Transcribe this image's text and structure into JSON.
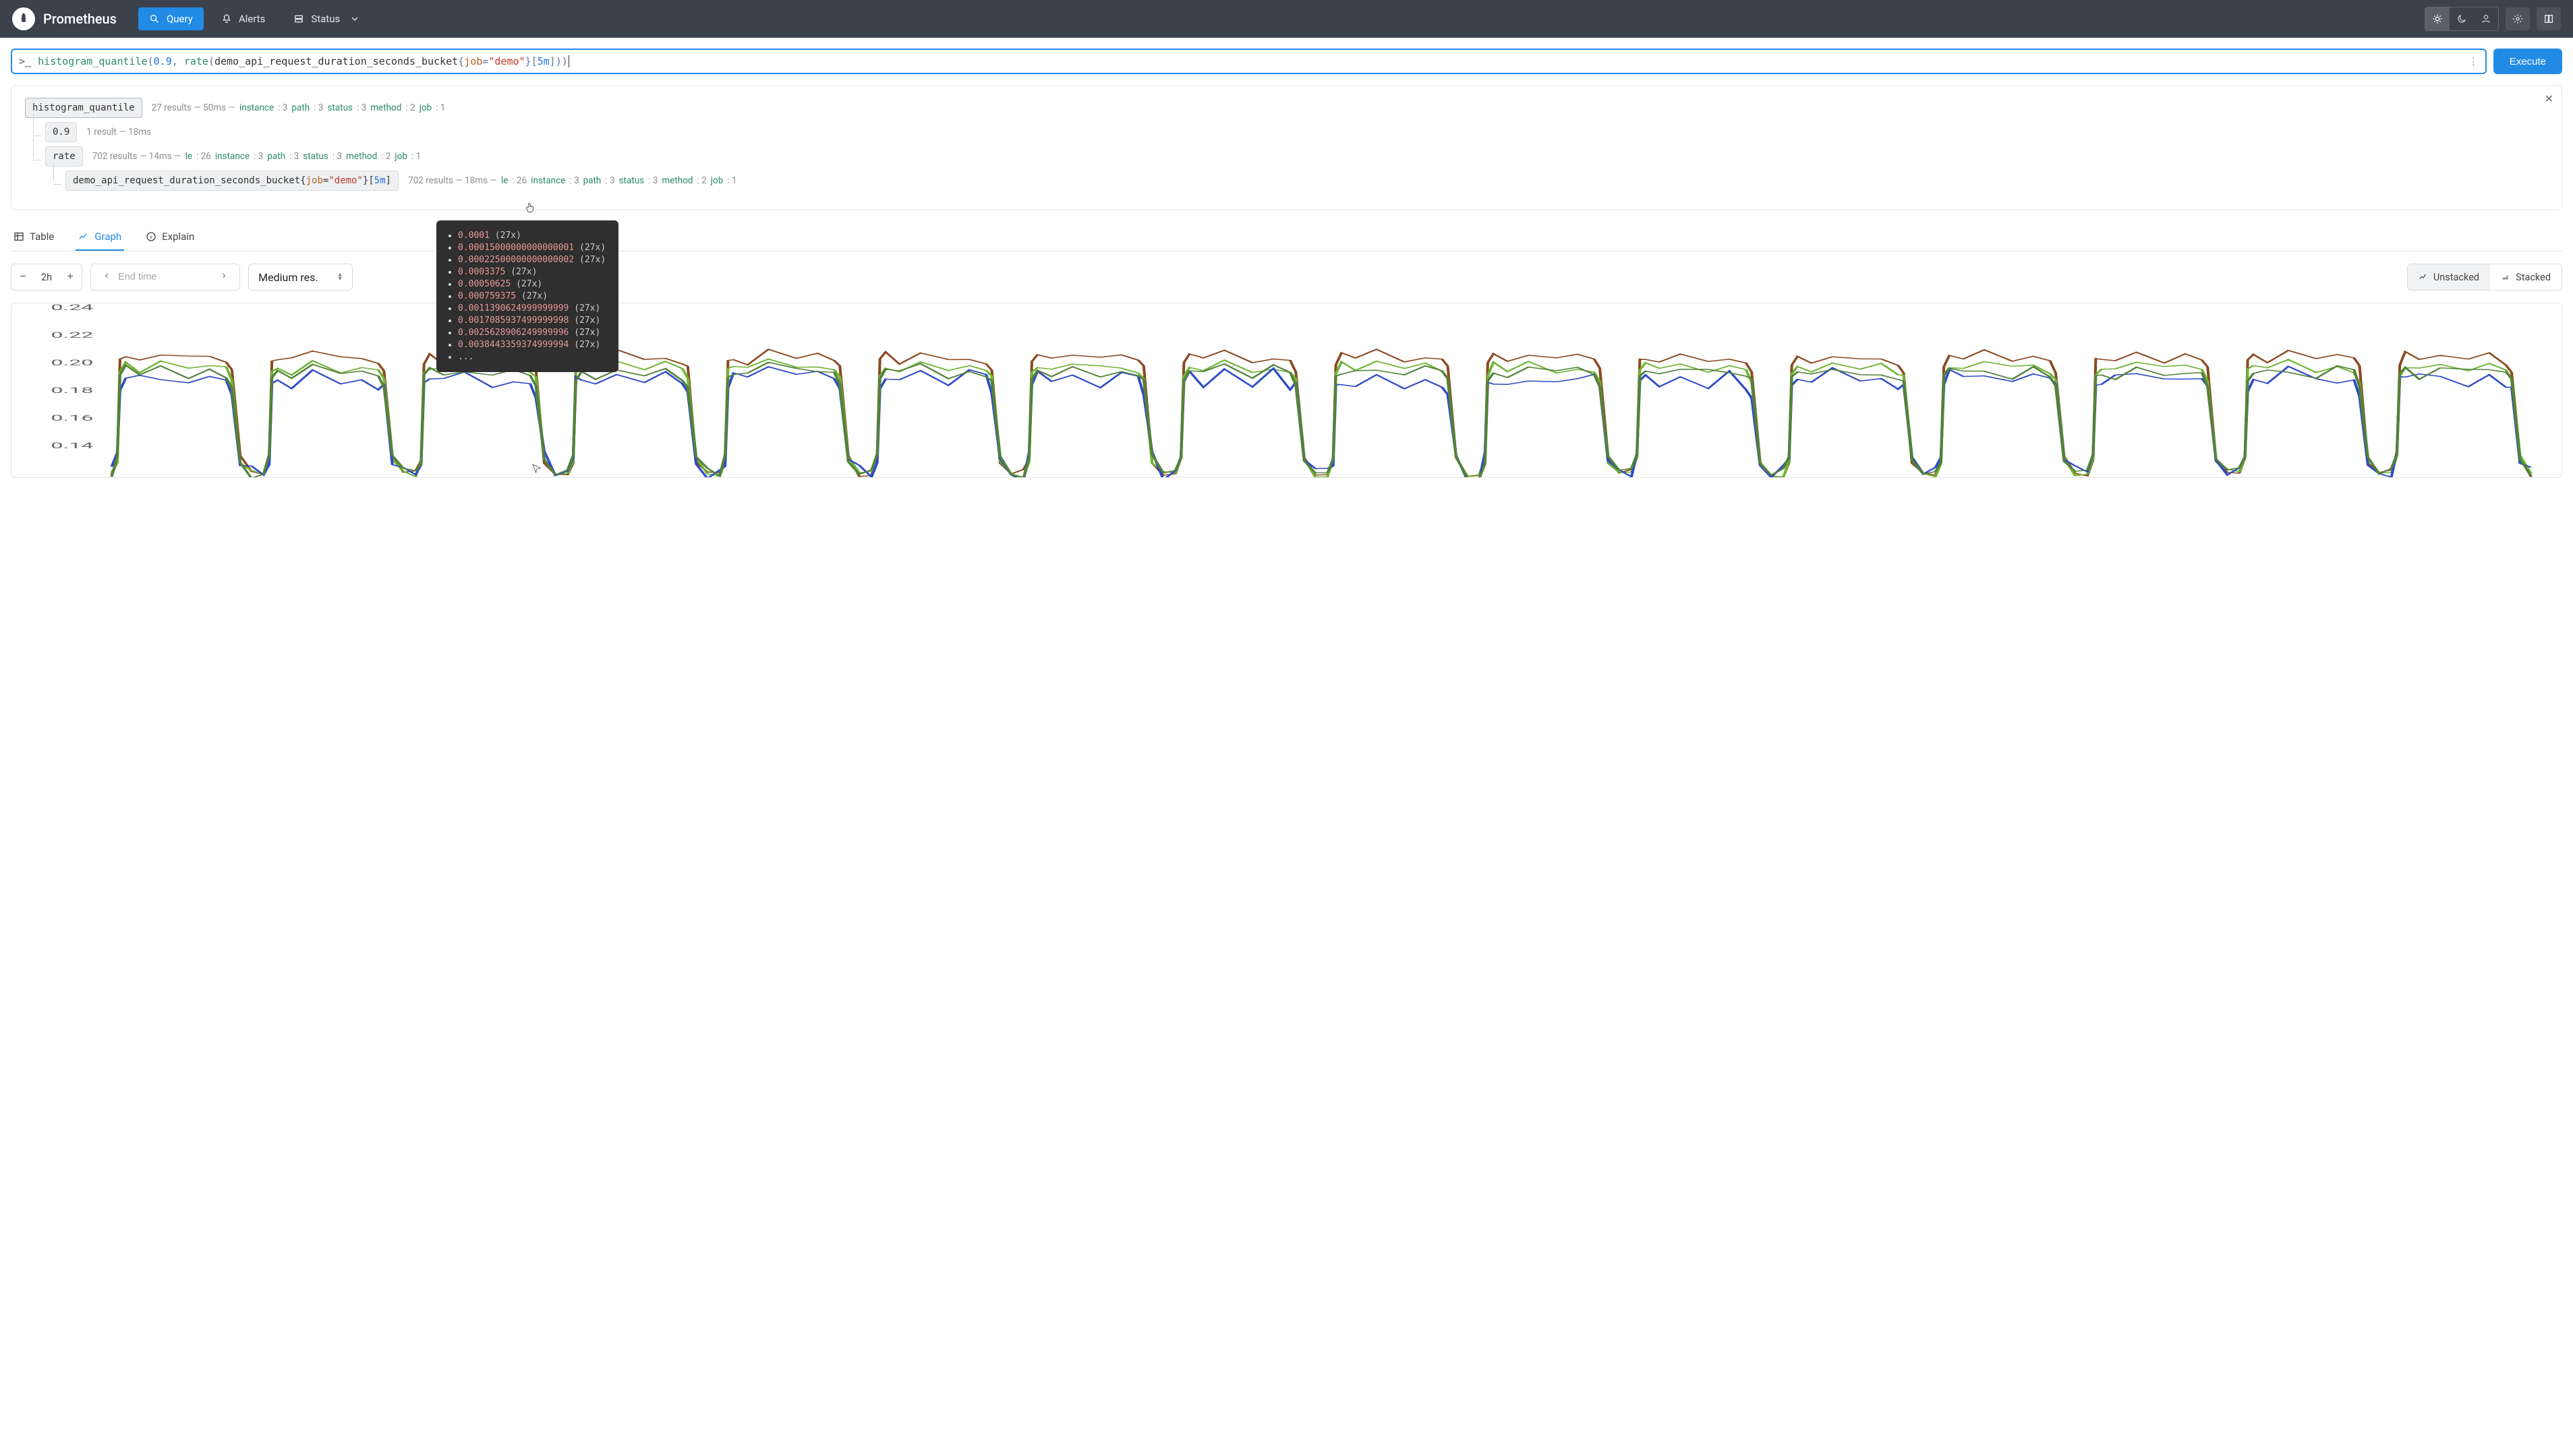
{
  "app": {
    "name": "Prometheus"
  },
  "nav": {
    "query": "Query",
    "alerts": "Alerts",
    "status": "Status"
  },
  "query": {
    "func1": "histogram_quantile",
    "quantile": "0.9",
    "func2": "rate",
    "metric": "demo_api_request_duration_seconds_bucket",
    "label_key": "job",
    "label_val": "\"demo\"",
    "range": "5m",
    "execute": "Execute"
  },
  "tree": {
    "n0": {
      "chip": "histogram_quantile",
      "meta_prefix": "27 results  —  50ms  —",
      "labels": [
        [
          "instance",
          "3"
        ],
        [
          "path",
          "3"
        ],
        [
          "status",
          "3"
        ],
        [
          "method",
          "2"
        ],
        [
          "job",
          "1"
        ]
      ]
    },
    "n1": {
      "chip": "0.9",
      "meta_prefix": "1 result  —  18ms"
    },
    "n2": {
      "chip": "rate",
      "meta_prefix": "702 results  —  14ms  —",
      "labels": [
        [
          "le",
          "26"
        ],
        [
          "instance",
          "3"
        ],
        [
          "path",
          "3"
        ],
        [
          "status",
          "3"
        ],
        [
          "method",
          "2"
        ],
        [
          "job",
          "1"
        ]
      ]
    },
    "n3": {
      "chip_metric": "demo_api_request_duration_seconds_bucket",
      "chip_lk": "job",
      "chip_lv": "\"demo\"",
      "chip_range": "5m",
      "meta_prefix": "702 results  —  18ms  —",
      "labels": [
        [
          "le",
          "26"
        ],
        [
          "instance",
          "3"
        ],
        [
          "path",
          "3"
        ],
        [
          "status",
          "3"
        ],
        [
          "method",
          "2"
        ],
        [
          "job",
          "1"
        ]
      ]
    }
  },
  "tooltip": {
    "items": [
      {
        "v": "0.0001",
        "c": "(27x)"
      },
      {
        "v": "0.00015000000000000001",
        "c": "(27x)"
      },
      {
        "v": "0.00022500000000000002",
        "c": "(27x)"
      },
      {
        "v": "0.0003375",
        "c": "(27x)"
      },
      {
        "v": "0.00050625",
        "c": "(27x)"
      },
      {
        "v": "0.000759375",
        "c": "(27x)"
      },
      {
        "v": "0.0011390624999999999",
        "c": "(27x)"
      },
      {
        "v": "0.0017085937499999998",
        "c": "(27x)"
      },
      {
        "v": "0.0025628906249999996",
        "c": "(27x)"
      },
      {
        "v": "0.0038443359374999994",
        "c": "(27x)"
      }
    ],
    "more": "..."
  },
  "tabs": {
    "table": "Table",
    "graph": "Graph",
    "explain": "Explain"
  },
  "controls": {
    "range": "2h",
    "end_placeholder": "End time",
    "resolution": "Medium res.",
    "unstacked": "Unstacked",
    "stacked": "Stacked"
  },
  "chart_data": {
    "type": "line",
    "ylim": [
      0.12,
      0.24
    ],
    "yticks": [
      0.14,
      0.16,
      0.18,
      0.2,
      0.22,
      0.24
    ],
    "cycles": 16,
    "cycle_shape_x": [
      0.0,
      0.04,
      0.06,
      0.1,
      0.2,
      0.35,
      0.55,
      0.7,
      0.82,
      0.86,
      0.92,
      1.0
    ],
    "series": [
      {
        "name": "s1",
        "color": "#8a4a20",
        "high": 0.205,
        "low": 0.12,
        "jitter": 0.003
      },
      {
        "name": "s2",
        "color": "#6fb436",
        "high": 0.198,
        "low": 0.12,
        "jitter": 0.003
      },
      {
        "name": "s3",
        "color": "#2e4bc7",
        "high": 0.19,
        "low": 0.12,
        "jitter": 0.006
      },
      {
        "name": "s4",
        "color": "#53823a",
        "high": 0.195,
        "low": 0.12,
        "jitter": 0.004
      }
    ]
  }
}
